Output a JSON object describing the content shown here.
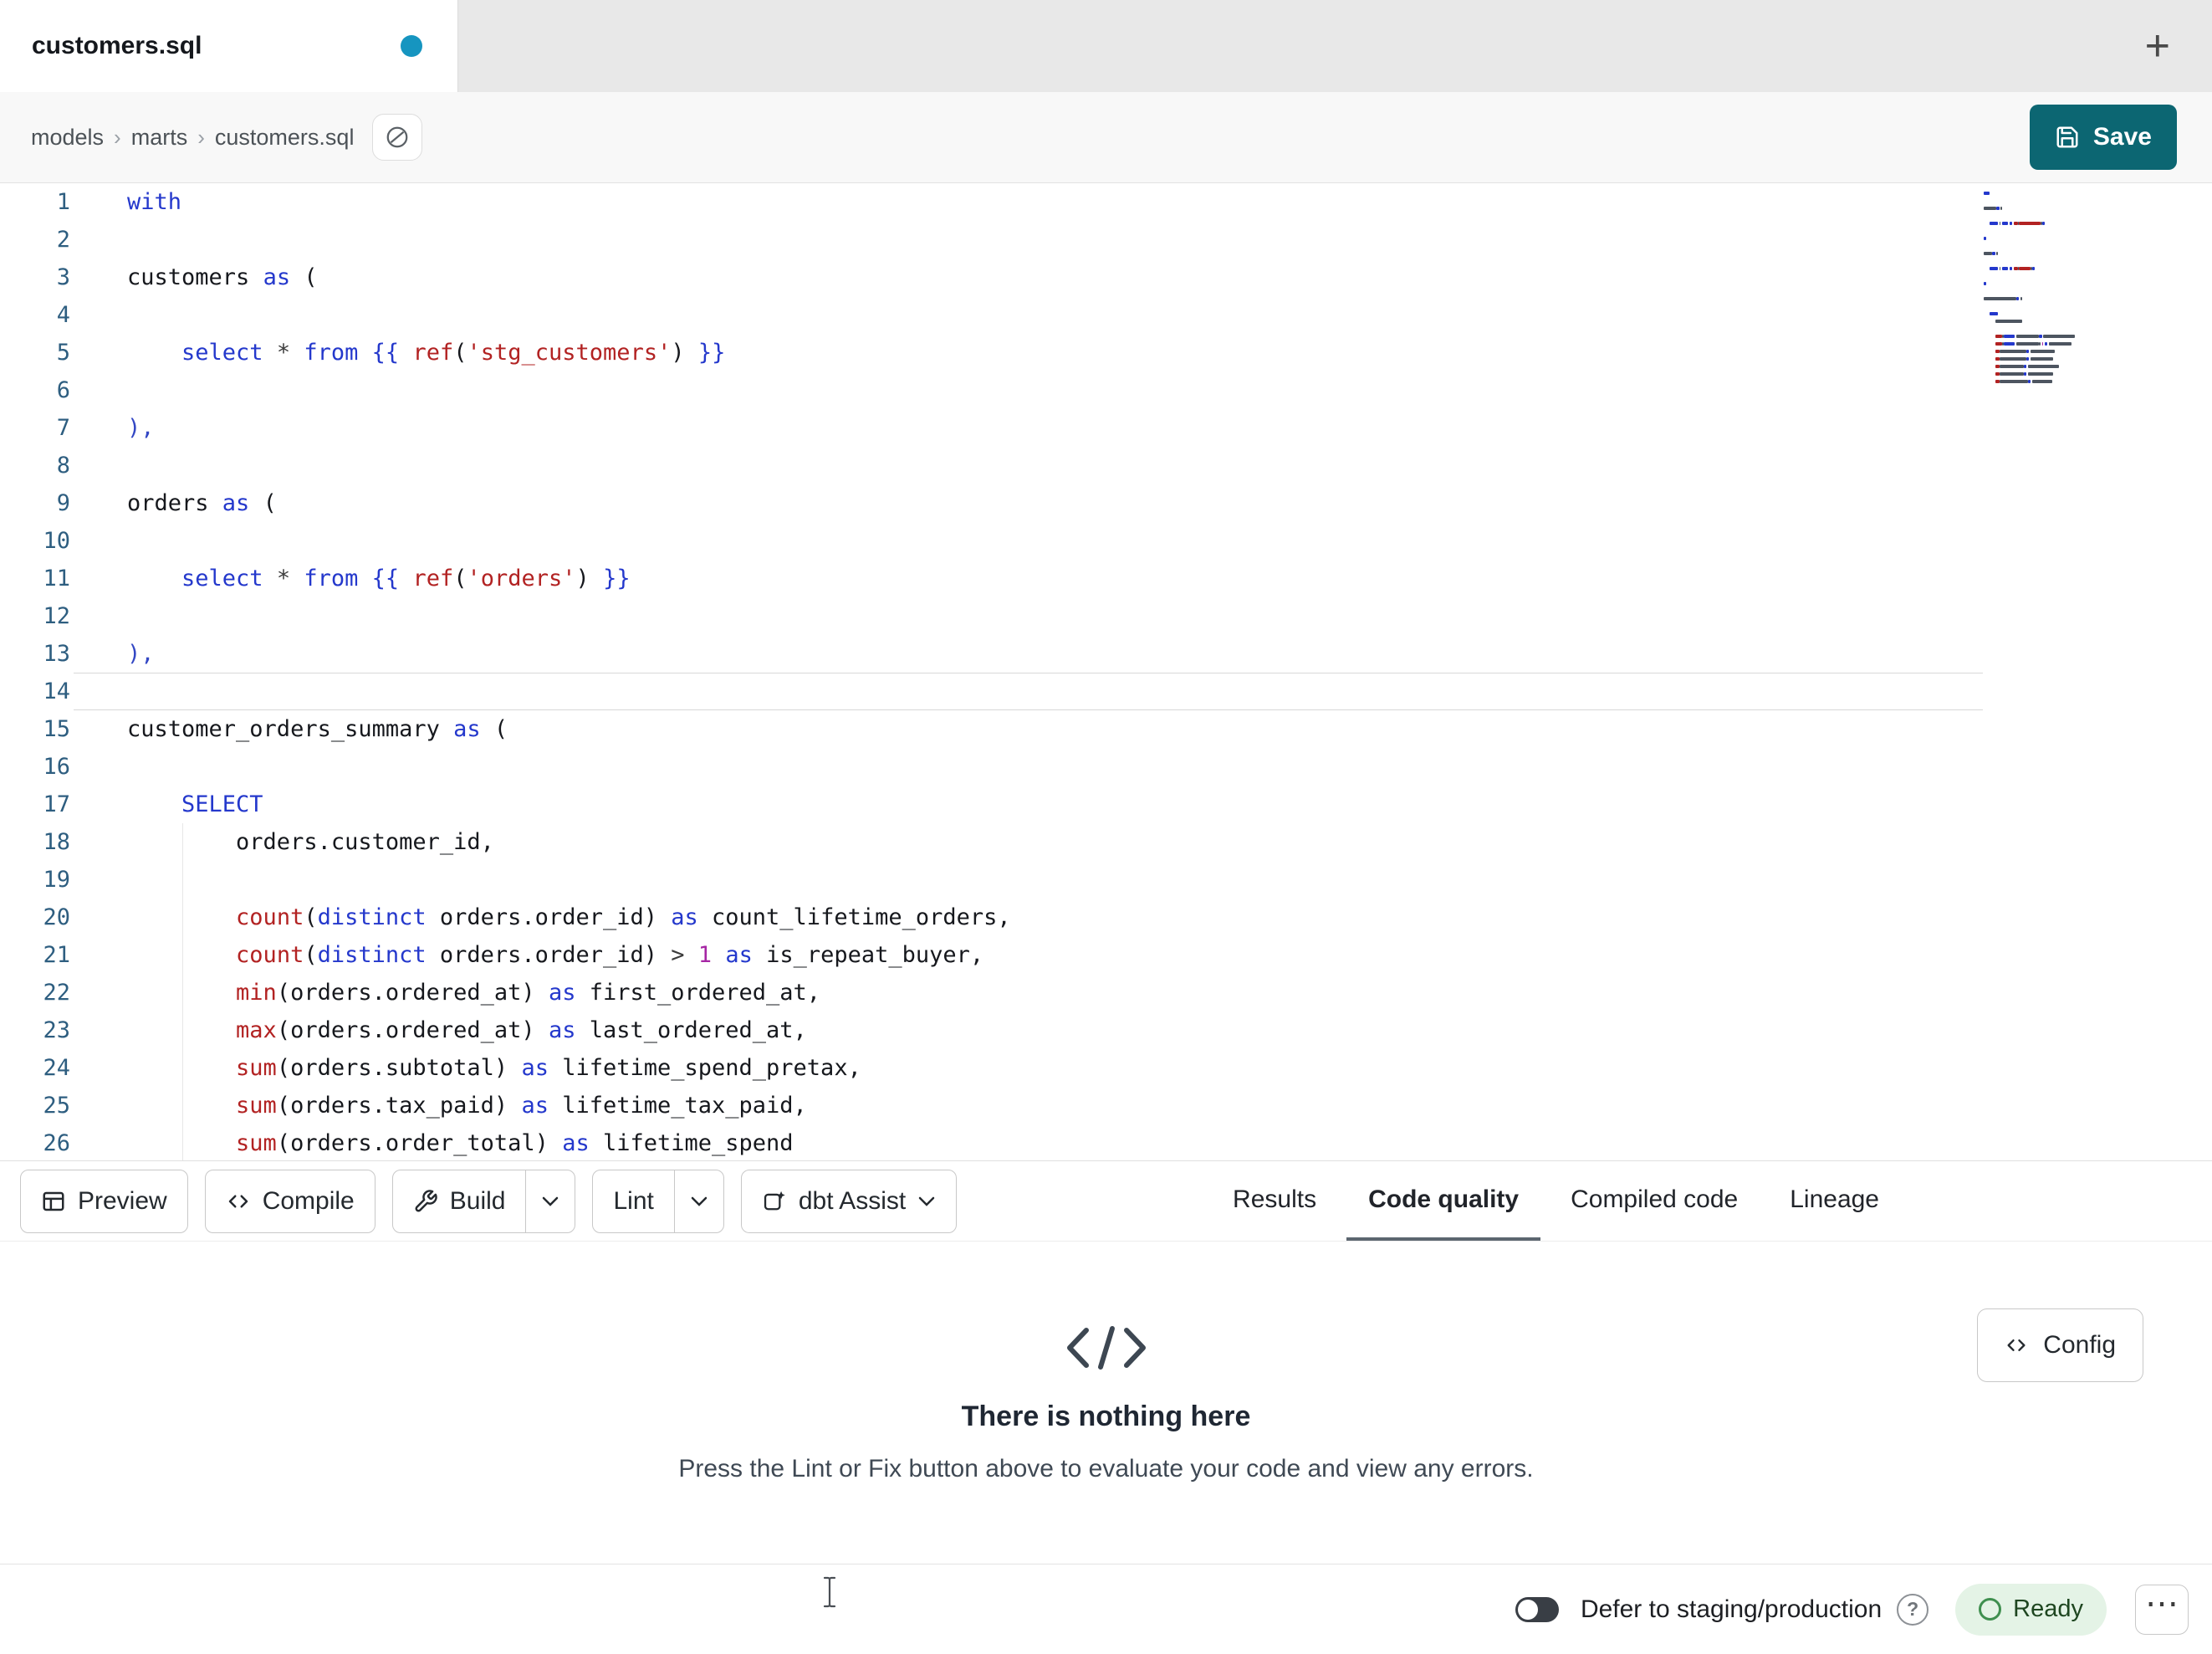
{
  "tab_bar": {
    "title": "customers.sql",
    "new_tab": "+"
  },
  "breadcrumb": {
    "items": [
      "models",
      "marts",
      "customers.sql"
    ],
    "separator": "›"
  },
  "save": {
    "label": "Save"
  },
  "editor": {
    "active_line": 14,
    "lines": [
      [
        [
          "kw",
          "with"
        ]
      ],
      [],
      [
        [
          "pl",
          "customers "
        ],
        [
          "kw",
          "as"
        ],
        [
          "pl",
          " ("
        ]
      ],
      [],
      [
        [
          "pl",
          "    "
        ],
        [
          "kw",
          "select"
        ],
        [
          "pl",
          " "
        ],
        [
          "op",
          "*"
        ],
        [
          "pl",
          " "
        ],
        [
          "kw",
          "from"
        ],
        [
          "pl",
          " "
        ],
        [
          "jinja",
          "{{"
        ],
        [
          "pl",
          " "
        ],
        [
          "fn",
          "ref"
        ],
        [
          "pl",
          "("
        ],
        [
          "str",
          "'stg_customers'"
        ],
        [
          "pl",
          ") "
        ],
        [
          "jinja",
          "}}"
        ]
      ],
      [],
      [
        [
          "br",
          "),"
        ]
      ],
      [],
      [
        [
          "pl",
          "orders "
        ],
        [
          "kw",
          "as"
        ],
        [
          "pl",
          " ("
        ]
      ],
      [],
      [
        [
          "pl",
          "    "
        ],
        [
          "kw",
          "select"
        ],
        [
          "pl",
          " "
        ],
        [
          "op",
          "*"
        ],
        [
          "pl",
          " "
        ],
        [
          "kw",
          "from"
        ],
        [
          "pl",
          " "
        ],
        [
          "jinja",
          "{{"
        ],
        [
          "pl",
          " "
        ],
        [
          "fn",
          "ref"
        ],
        [
          "pl",
          "("
        ],
        [
          "str",
          "'orders'"
        ],
        [
          "pl",
          ") "
        ],
        [
          "jinja",
          "}}"
        ]
      ],
      [],
      [
        [
          "br",
          "),"
        ]
      ],
      [],
      [
        [
          "pl",
          "customer_orders_summary "
        ],
        [
          "kw",
          "as"
        ],
        [
          "pl",
          " ("
        ]
      ],
      [],
      [
        [
          "pl",
          "    "
        ],
        [
          "kw",
          "SELECT"
        ]
      ],
      [
        [
          "pl",
          "        orders.customer_id,"
        ]
      ],
      [],
      [
        [
          "pl",
          "        "
        ],
        [
          "fn",
          "count"
        ],
        [
          "pl",
          "("
        ],
        [
          "kw",
          "distinct"
        ],
        [
          "pl",
          " orders.order_id) "
        ],
        [
          "kw",
          "as"
        ],
        [
          "pl",
          " count_lifetime_orders,"
        ]
      ],
      [
        [
          "pl",
          "        "
        ],
        [
          "fn",
          "count"
        ],
        [
          "pl",
          "("
        ],
        [
          "kw",
          "distinct"
        ],
        [
          "pl",
          " orders.order_id) "
        ],
        [
          "op",
          ">"
        ],
        [
          "pl",
          " "
        ],
        [
          "num",
          "1"
        ],
        [
          "pl",
          " "
        ],
        [
          "kw",
          "as"
        ],
        [
          "pl",
          " is_repeat_buyer,"
        ]
      ],
      [
        [
          "pl",
          "        "
        ],
        [
          "fn",
          "min"
        ],
        [
          "pl",
          "(orders.ordered_at) "
        ],
        [
          "kw",
          "as"
        ],
        [
          "pl",
          " first_ordered_at,"
        ]
      ],
      [
        [
          "pl",
          "        "
        ],
        [
          "fn",
          "max"
        ],
        [
          "pl",
          "(orders.ordered_at) "
        ],
        [
          "kw",
          "as"
        ],
        [
          "pl",
          " last_ordered_at,"
        ]
      ],
      [
        [
          "pl",
          "        "
        ],
        [
          "fn",
          "sum"
        ],
        [
          "pl",
          "(orders.subtotal) "
        ],
        [
          "kw",
          "as"
        ],
        [
          "pl",
          " lifetime_spend_pretax,"
        ]
      ],
      [
        [
          "pl",
          "        "
        ],
        [
          "fn",
          "sum"
        ],
        [
          "pl",
          "(orders.tax_paid) "
        ],
        [
          "kw",
          "as"
        ],
        [
          "pl",
          " lifetime_tax_paid,"
        ]
      ],
      [
        [
          "pl",
          "        "
        ],
        [
          "fn",
          "sum"
        ],
        [
          "pl",
          "(orders.order_total) "
        ],
        [
          "kw",
          "as"
        ],
        [
          "pl",
          " lifetime_spend"
        ]
      ]
    ]
  },
  "toolbar": {
    "preview": "Preview",
    "compile": "Compile",
    "build": "Build",
    "lint": "Lint",
    "assist": "dbt Assist"
  },
  "tabs": [
    {
      "label": "Results"
    },
    {
      "label": "Code quality"
    },
    {
      "label": "Compiled code"
    },
    {
      "label": "Lineage"
    }
  ],
  "empty_state": {
    "title": "There is nothing here",
    "subtitle": "Press the Lint or Fix button above to evaluate your code and view any errors.",
    "config": "Config"
  },
  "statusbar": {
    "defer_label": "Defer to staging/production",
    "help": "?",
    "ready": "Ready",
    "menu": "⋯"
  },
  "colors": {
    "kw": "#2438cc",
    "jinja": "#2438cc",
    "br": "#3347c4",
    "fn": "#b22222",
    "str": "#b22222",
    "num": "#a626a4",
    "op": "#3c3c3c",
    "pl": "#16181d",
    "gutter": "#2e5e80",
    "accent": "#0c6672",
    "dot": "#1695c0",
    "underline": "#5c6670",
    "ready_bg": "#e4f3e6",
    "ready_text": "#1e4620",
    "ready_circle": "#3f8f4f"
  }
}
